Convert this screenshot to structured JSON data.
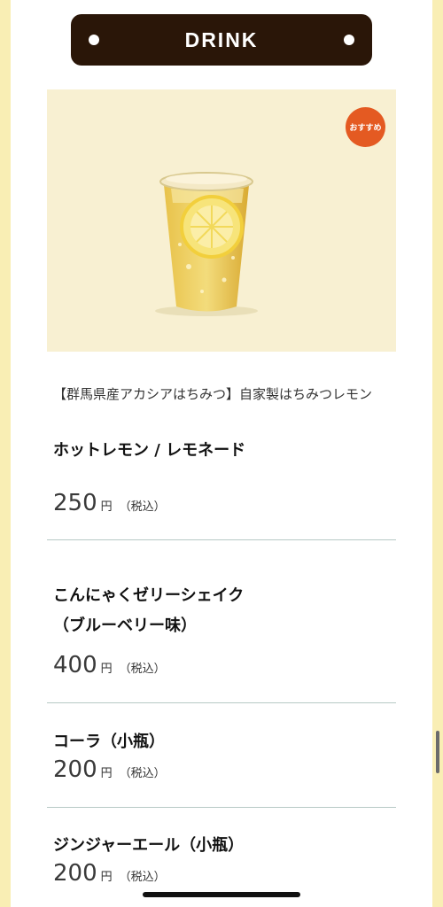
{
  "header": {
    "title": "DRINK"
  },
  "featured": {
    "badge": "おすすめ",
    "subtitle": "【群馬県産アカシアはちみつ】自家製はちみつレモン"
  },
  "items": [
    {
      "name": "ホットレモン / レモネード",
      "price": "250",
      "yen": "円",
      "tax": "（税込）"
    },
    {
      "name": "こんにゃくゼリーシェイク\n（ブルーベリー味）",
      "name_line1": "こんにゃくゼリーシェイク",
      "name_line2": "（ブルーベリー味）",
      "price": "400",
      "yen": "円",
      "tax": "（税込）"
    },
    {
      "name": "コーラ（小瓶）",
      "price": "200",
      "yen": "円",
      "tax": "（税込）"
    },
    {
      "name": "ジンジャーエール（小瓶）",
      "price": "200",
      "yen": "円",
      "tax": "（税込）"
    }
  ],
  "colors": {
    "background": "#f9eeb4",
    "header_bar": "#2a1608",
    "badge": "#e45a22",
    "divider": "#b7c9c5"
  }
}
